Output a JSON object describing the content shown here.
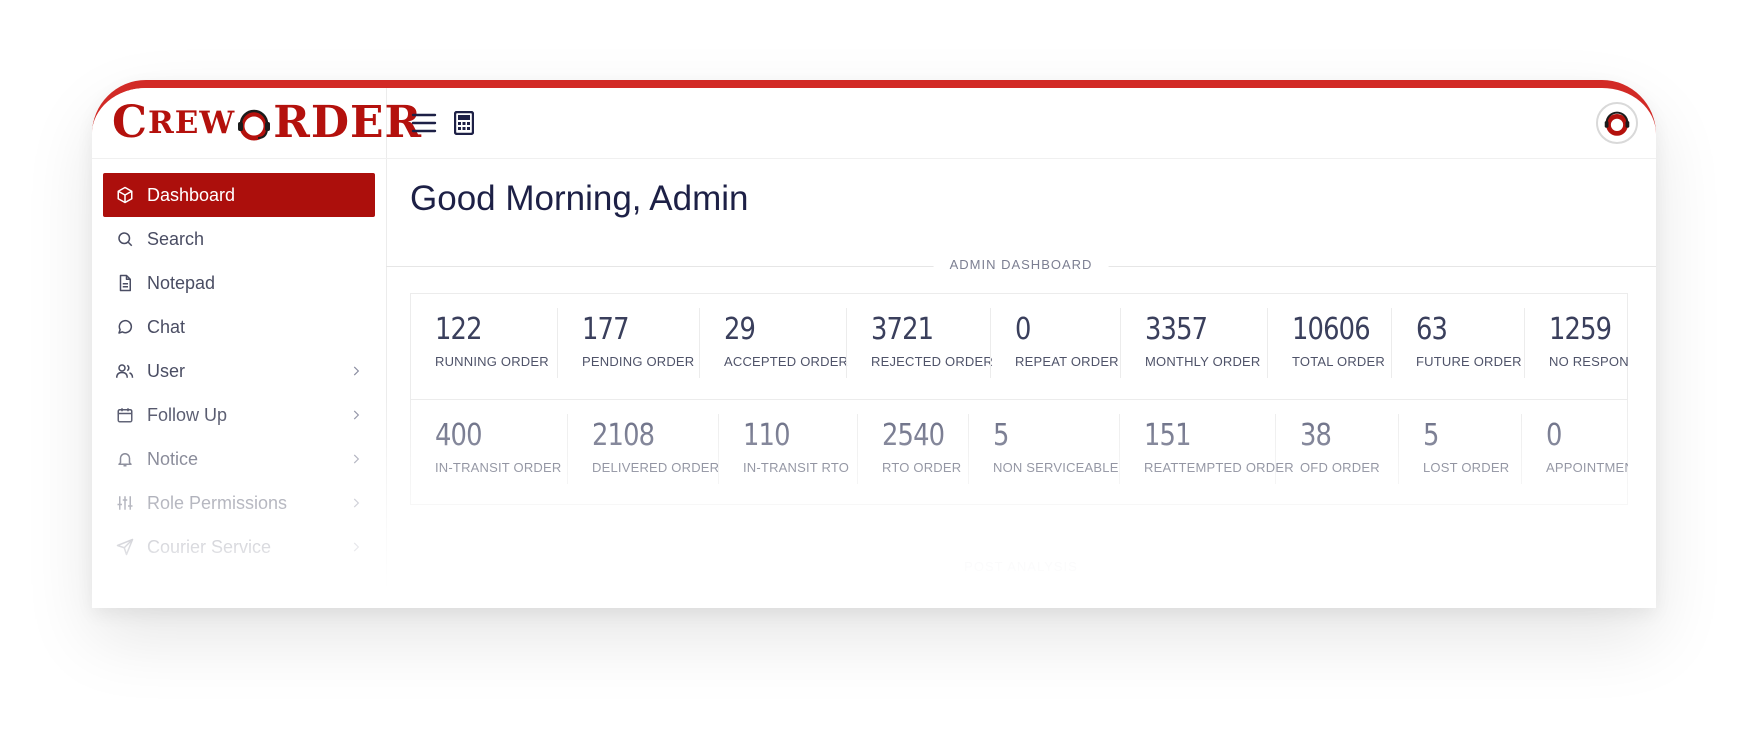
{
  "app": {
    "logo_text_1": "C",
    "logo_text_2": "REW",
    "logo_text_3": "O",
    "logo_text_4": "RDER",
    "brand_color": "#b4110d",
    "accent_color": "#d22a26"
  },
  "sidebar": {
    "items": [
      {
        "label": "Dashboard",
        "icon": "cube-icon",
        "active": true,
        "has_submenu": false
      },
      {
        "label": "Search",
        "icon": "search-icon",
        "active": false,
        "has_submenu": false
      },
      {
        "label": "Notepad",
        "icon": "document-icon",
        "active": false,
        "has_submenu": false
      },
      {
        "label": "Chat",
        "icon": "chat-icon",
        "active": false,
        "has_submenu": false
      },
      {
        "label": "User",
        "icon": "users-icon",
        "active": false,
        "has_submenu": true
      },
      {
        "label": "Follow Up",
        "icon": "calendar-icon",
        "active": false,
        "has_submenu": true
      },
      {
        "label": "Notice",
        "icon": "bell-icon",
        "active": false,
        "has_submenu": true
      },
      {
        "label": "Role Permissions",
        "icon": "sliders-icon",
        "active": false,
        "has_submenu": true
      },
      {
        "label": "Courier Service",
        "icon": "send-icon",
        "active": false,
        "has_submenu": true
      }
    ]
  },
  "topbar": {
    "menu_icon": "hamburger-icon",
    "calculator_icon": "calculator-icon",
    "avatar_icon": "support-headset-avatar"
  },
  "main": {
    "greeting": "Good Morning, Admin",
    "section_label": "ADMIN DASHBOARD",
    "second_section_label": "POST ANALYSIS",
    "row1": [
      {
        "value": "122",
        "label": "RUNNING ORDER"
      },
      {
        "value": "177",
        "label": "PENDING ORDER"
      },
      {
        "value": "29",
        "label": "ACCEPTED ORDER"
      },
      {
        "value": "3721",
        "label": "REJECTED ORDER"
      },
      {
        "value": "0",
        "label": "REPEAT ORDER"
      },
      {
        "value": "3357",
        "label": "MONTHLY ORDER"
      },
      {
        "value": "10606",
        "label": "TOTAL ORDER"
      },
      {
        "value": "63",
        "label": "FUTURE ORDER"
      },
      {
        "value": "1259",
        "label": "NO RESPONSE"
      }
    ],
    "row2": [
      {
        "value": "400",
        "label": "IN-TRANSIT ORDER"
      },
      {
        "value": "2108",
        "label": "DELIVERED ORDER"
      },
      {
        "value": "110",
        "label": "IN-TRANSIT RTO"
      },
      {
        "value": "2540",
        "label": "RTO ORDER"
      },
      {
        "value": "5",
        "label": "NON SERVICEABLE"
      },
      {
        "value": "151",
        "label": "REATTEMPTED ORDER"
      },
      {
        "value": "38",
        "label": "OFD ORDER"
      },
      {
        "value": "5",
        "label": "LOST ORDER"
      },
      {
        "value": "0",
        "label": "APPOINTMENT"
      }
    ]
  }
}
